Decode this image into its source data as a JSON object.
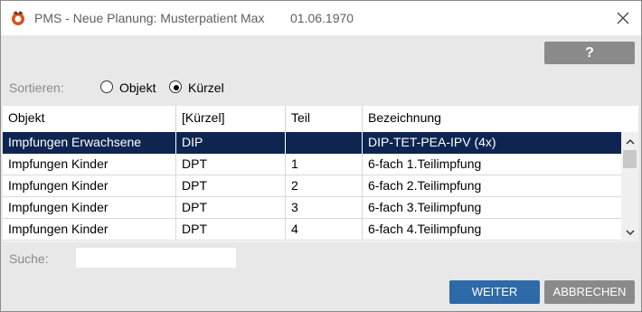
{
  "window": {
    "title": "PMS - Neue Planung: Musterpatient Max",
    "date": "01.06.1970"
  },
  "toolbar": {
    "help_label": "?"
  },
  "sort": {
    "label": "Sortieren:",
    "options": [
      {
        "label": "Objekt",
        "selected": false
      },
      {
        "label": "Kürzel",
        "selected": true
      }
    ]
  },
  "table": {
    "columns": [
      "Objekt",
      "[Kürzel]",
      "Teil",
      "Bezeichnung"
    ],
    "rows": [
      {
        "objekt": "Impfungen Erwachsene",
        "kuerzel": "DIP",
        "teil": "",
        "bezeichnung": "DIP-TET-PEA-IPV (4x)",
        "selected": true
      },
      {
        "objekt": "Impfungen Kinder",
        "kuerzel": "DPT",
        "teil": "1",
        "bezeichnung": "6-fach 1.Teilimpfung",
        "selected": false
      },
      {
        "objekt": "Impfungen Kinder",
        "kuerzel": "DPT",
        "teil": "2",
        "bezeichnung": "6-fach 2.Teilimpfung",
        "selected": false
      },
      {
        "objekt": "Impfungen Kinder",
        "kuerzel": "DPT",
        "teil": "3",
        "bezeichnung": "6-fach 3.Teilimpfung",
        "selected": false
      },
      {
        "objekt": "Impfungen Kinder",
        "kuerzel": "DPT",
        "teil": "4",
        "bezeichnung": "6-fach 4.Teilimpfung",
        "selected": false
      }
    ]
  },
  "search": {
    "label": "Suche:",
    "value": "",
    "placeholder": ""
  },
  "buttons": {
    "weiter": "WEITER",
    "abbrechen": "ABBRECHEN"
  },
  "colors": {
    "selection": "#0f2551",
    "primary_button": "#2e6aa7",
    "secondary_button": "#8a8a8a",
    "dialog_background": "#e8e8e8"
  },
  "icons": {
    "app": "app-logo-icon",
    "close": "close-icon",
    "scroll_up": "chevron-up-icon",
    "scroll_down": "chevron-down-icon"
  }
}
